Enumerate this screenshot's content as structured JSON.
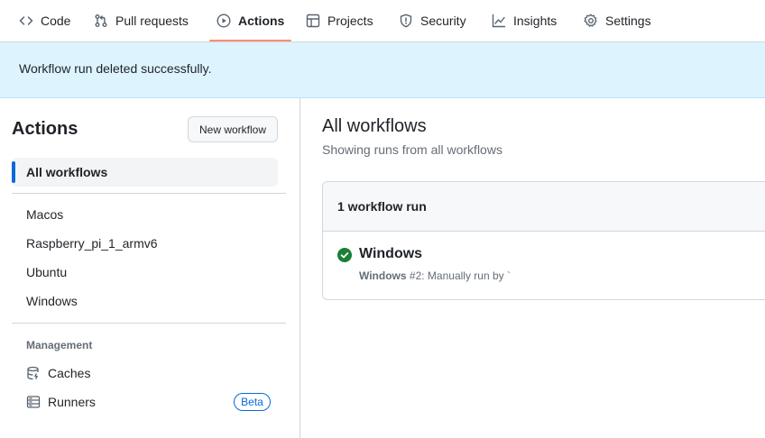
{
  "tabs": [
    {
      "label": "Code",
      "icon": "code-icon"
    },
    {
      "label": "Pull requests",
      "icon": "git-pull-request-icon"
    },
    {
      "label": "Actions",
      "icon": "play-icon",
      "active": true
    },
    {
      "label": "Projects",
      "icon": "table-icon"
    },
    {
      "label": "Security",
      "icon": "shield-icon"
    },
    {
      "label": "Insights",
      "icon": "graph-icon"
    },
    {
      "label": "Settings",
      "icon": "gear-icon"
    }
  ],
  "flash": {
    "message": "Workflow run deleted successfully."
  },
  "sidebar": {
    "title": "Actions",
    "new_workflow_label": "New workflow",
    "all_workflows_label": "All workflows",
    "workflows": [
      "Macos",
      "Raspberry_pi_1_armv6",
      "Ubuntu",
      "Windows"
    ],
    "management_label": "Management",
    "management_items": [
      {
        "label": "Caches",
        "icon": "database-icon"
      },
      {
        "label": "Runners",
        "icon": "server-icon",
        "badge": "Beta"
      }
    ]
  },
  "main": {
    "title": "All workflows",
    "subtitle": "Showing runs from all workflows",
    "run_count_label": "1 workflow run",
    "runs": [
      {
        "title": "Windows",
        "workflow": "Windows",
        "number": "#2",
        "meta": ": Manually run by `",
        "status": "success"
      }
    ]
  },
  "colors": {
    "accent": "#0969da",
    "success": "#1a7f37",
    "tab_underline": "#fd8c73",
    "flash_bg": "#ddf4ff"
  }
}
